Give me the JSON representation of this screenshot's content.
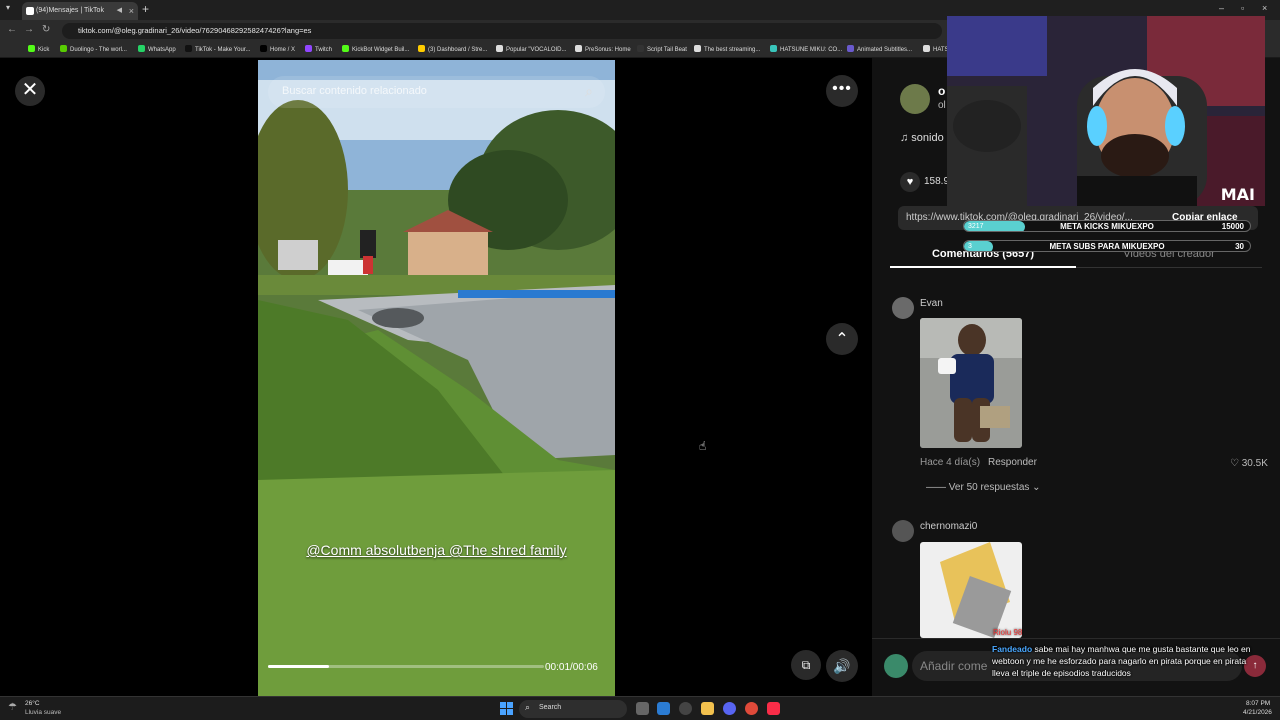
{
  "browser": {
    "tab_title": "(94)Mensajes | TikTok",
    "new_tab_icon": "+",
    "url": "tiktok.com/@oleg.gradinari_26/video/7629046829258247426?lang=es",
    "bookmarks": [
      {
        "label": "Kick",
        "color": "#53fc18"
      },
      {
        "label": "Duolingo - The worl...",
        "color": "#58cc02"
      },
      {
        "label": "WhatsApp",
        "color": "#25d366"
      },
      {
        "label": "TikTok - Make Your...",
        "color": "#111111"
      },
      {
        "label": "Home / X",
        "color": "#000000"
      },
      {
        "label": "Twitch",
        "color": "#9146ff"
      },
      {
        "label": "KickBot Widget Buil...",
        "color": "#53fc18"
      },
      {
        "label": "(3) Dashboard / Stre...",
        "color": "#ffcc00"
      },
      {
        "label": "Popular \"VOCALOID...",
        "color": "#dddddd"
      },
      {
        "label": "PreSonus: Home",
        "color": "#dddddd"
      },
      {
        "label": "Script Tail Beat",
        "color": "#333333"
      },
      {
        "label": "The best streaming...",
        "color": "#dddddd"
      },
      {
        "label": "HATSUNE MIKU: CO...",
        "color": "#39c5bb"
      },
      {
        "label": "Animated Subtitles...",
        "color": "#6a5acd"
      },
      {
        "label": "HATS",
        "color": "#dddddd"
      }
    ]
  },
  "video": {
    "search_placeholder": "Buscar contenido relacionado",
    "caption": "@Comm absolutbenja @The shred family",
    "progress": 0.22,
    "time": "00:01/00:06"
  },
  "panel": {
    "author_initial": "o",
    "author_handle": "ol",
    "music": "♫  sonido",
    "likes": "158.9",
    "link_url": "https://www.tiktok.com/@oleg.gradinari_26/video/...",
    "copy_link": "Copiar enlace",
    "tab_comments": "Comentarios (5657)",
    "tab_creator": "Videos del creador",
    "comments": [
      {
        "user": "Evan",
        "meta": "Hace 4 día(s)",
        "reply": "Responder",
        "likes": "30.5K",
        "more": "Ver 50 respuestas"
      },
      {
        "user": "chernomazi0"
      }
    ],
    "compose_placeholder": "Añadir come"
  },
  "overlay": {
    "logo": "MAI",
    "kicks": {
      "label": "META KICKS MIKUEXPO",
      "current": "3217",
      "goal": "15000",
      "fraction": 0.2145
    },
    "subs": {
      "label": "META SUBS PARA MIKUEXPO",
      "current": "3",
      "goal": "30",
      "fraction": 0.1
    },
    "chat_user2": "Riolu 98",
    "chat_user": "Fandeado",
    "chat_text": "sabe mai hay manhwa que me gusta bastante que leo en webtoon y me he esforzado para nagarlo en pirata porque en pirata lleva el triple de episodios traducidos"
  },
  "taskbar": {
    "weather_temp": "26°C",
    "weather_desc": "Lluvia suave",
    "search": "Search",
    "time": "8:07 PM",
    "date": "4/21/2026"
  }
}
